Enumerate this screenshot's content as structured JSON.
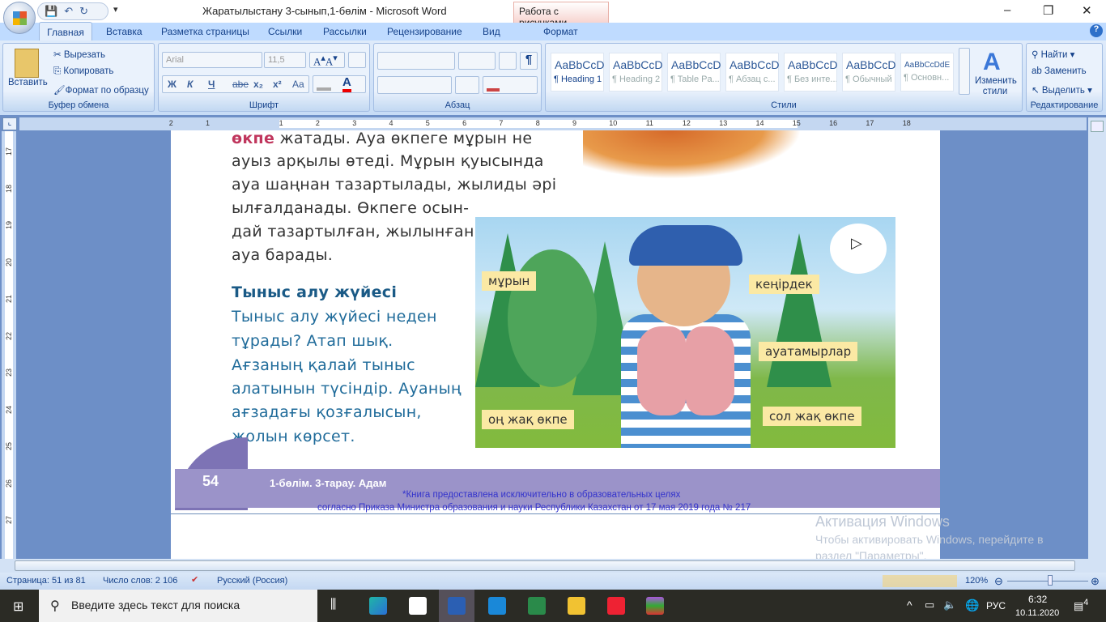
{
  "window": {
    "title": "Жаратылыстану 3-сынып,1-бөлім - Microsoft Word",
    "context_tab": "Работа с рисунками",
    "minimize": "–",
    "restore": "❐",
    "close": "✕"
  },
  "tabs": [
    "Главная",
    "Вставка",
    "Разметка страницы",
    "Ссылки",
    "Рассылки",
    "Рецензирование",
    "Вид",
    "Формат"
  ],
  "clipboard": {
    "paste": "Вставить",
    "cut": "Вырезать",
    "copy": "Копировать",
    "format_painter": "Формат по образцу",
    "label": "Буфер обмена"
  },
  "font": {
    "name": "Arial",
    "size": "11,5",
    "label": "Шрифт",
    "bold": "Ж",
    "italic": "К",
    "underline": "Ч",
    "strike": "abe",
    "sub": "x₂",
    "sup": "x²",
    "case": "Aa"
  },
  "paragraph": {
    "label": "Абзац",
    "pilcrow": "¶"
  },
  "styles": {
    "label": "Стили",
    "items": [
      {
        "sample": "AaBbCcD",
        "name": "¶ Heading 1"
      },
      {
        "sample": "AaBbCcD",
        "name": "¶ Heading 2"
      },
      {
        "sample": "AaBbCcD",
        "name": "¶ Table Pa..."
      },
      {
        "sample": "AaBbCcD",
        "name": "¶ Абзац с..."
      },
      {
        "sample": "AaBbCcD",
        "name": "¶ Без инте..."
      },
      {
        "sample": "AaBbCcD",
        "name": "¶ Обычный"
      },
      {
        "sample": "AaBbCcDdE",
        "name": "¶ Основн..."
      }
    ],
    "change": "Изменить стили"
  },
  "editing": {
    "find": "Найти",
    "replace": "Заменить",
    "select": "Выделить",
    "label": "Редактирование"
  },
  "ruler_h": [
    "2",
    "1",
    "1",
    "2",
    "3",
    "4",
    "5",
    "6",
    "7",
    "8",
    "9",
    "10",
    "11",
    "12",
    "13",
    "14",
    "15",
    "16",
    "17",
    "18"
  ],
  "ruler_v": [
    "17",
    "18",
    "19",
    "20",
    "21",
    "22",
    "23",
    "24",
    "25",
    "26",
    "27"
  ],
  "document": {
    "lines": [
      "өкпе жатады. Ауа өкпеге мұрын не",
      "ауыз арқылы өтеді. Мұрын қуысында",
      "ауа шаңнан тазартылады, жылиды әрі",
      "ылғалданады. Өкпеге осын-",
      "дай тазартылған, жылынған",
      "ауа барады."
    ],
    "heading": "Тыныс алу жүйесі",
    "question": [
      "Тыныс алу жүйесі неден",
      "тұрады? Атап шық.",
      "Ағзаның қалай тыныс",
      "алатынын түсіндір. Ауаның",
      "ағзадағы қозғалысын,",
      "жолын көрсет."
    ],
    "labels": [
      "мұрын",
      "кеңірдек",
      "ауатамырлар",
      "оң жақ өкпе",
      "сол жақ өкпе"
    ],
    "page_number": "54",
    "section": "1-бөлім. 3-тарау. Адам",
    "notice": [
      "*Книга предоставлена исключительно в образовательных целях",
      "согласно Приказа Министра образования и науки Республики Казахстан от 17 мая 2019 года № 217"
    ]
  },
  "watermark": {
    "title": "Активация Windows",
    "line1": "Чтобы активировать Windows, перейдите в",
    "line2": "раздел \"Параметры\"."
  },
  "status": {
    "page": "Страница: 51 из 81",
    "words": "Число слов: 2 106",
    "language": "Русский (Россия)",
    "zoom": "120%",
    "zoom_percent": 120
  },
  "taskbar": {
    "search_placeholder": "Введите здесь текст для поиска",
    "lang": "РУС",
    "time": "6:32",
    "date": "10.11.2020",
    "notifications": "4"
  }
}
